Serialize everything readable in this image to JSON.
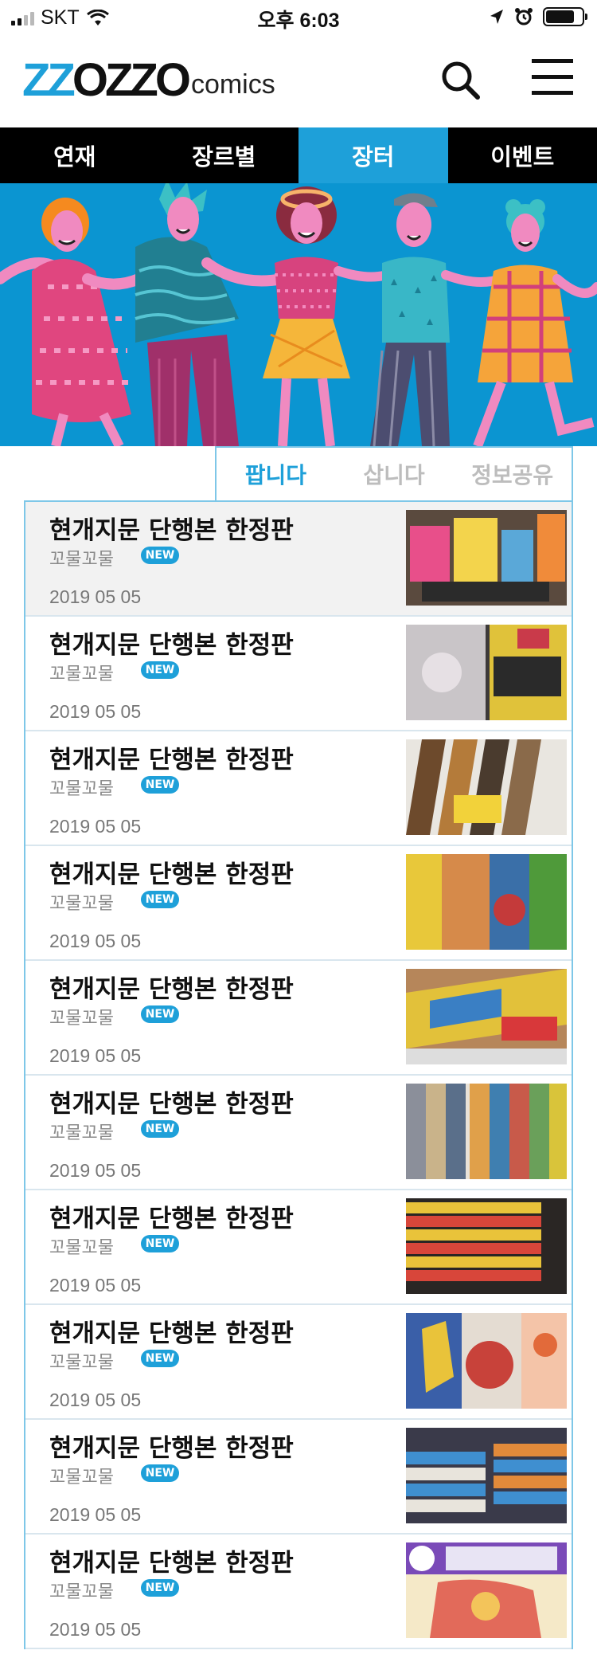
{
  "status_bar": {
    "carrier": "SKT",
    "time": "오후 6:03"
  },
  "header": {
    "logo_main_blue": "ZZ",
    "logo_main_black": "OZZO",
    "logo_sub": "comics"
  },
  "tabs": [
    {
      "label": "연재",
      "active": false
    },
    {
      "label": "장르별",
      "active": false
    },
    {
      "label": "장터",
      "active": true
    },
    {
      "label": "이벤트",
      "active": false
    }
  ],
  "subtabs": [
    {
      "label": "팝니다",
      "active": true
    },
    {
      "label": "삽니다",
      "active": false
    },
    {
      "label": "정보공유",
      "active": false
    }
  ],
  "badge_label": "NEW",
  "colors": {
    "accent": "#1ea0d9",
    "tab_bar": "#000000",
    "banner_bg": "#0b95d1"
  },
  "items": [
    {
      "title": "현개지문 단행본 한정판",
      "author": "꼬물꼬물",
      "date": "2019 05 05"
    },
    {
      "title": "현개지문 단행본 한정판",
      "author": "꼬물꼬물",
      "date": "2019 05 05"
    },
    {
      "title": "현개지문 단행본 한정판",
      "author": "꼬물꼬물",
      "date": "2019 05 05"
    },
    {
      "title": "현개지문 단행본 한정판",
      "author": "꼬물꼬물",
      "date": "2019 05 05"
    },
    {
      "title": "현개지문 단행본 한정판",
      "author": "꼬물꼬물",
      "date": "2019 05 05"
    },
    {
      "title": "현개지문 단행본 한정판",
      "author": "꼬물꼬물",
      "date": "2019 05 05"
    },
    {
      "title": "현개지문 단행본 한정판",
      "author": "꼬물꼬물",
      "date": "2019 05 05"
    },
    {
      "title": "현개지문 단행본 한정판",
      "author": "꼬물꼬물",
      "date": "2019 05 05"
    },
    {
      "title": "현개지문 단행본 한정판",
      "author": "꼬물꼬물",
      "date": "2019 05 05"
    },
    {
      "title": "현개지문 단행본 한정판",
      "author": "꼬물꼬물",
      "date": "2019 05 05"
    }
  ]
}
